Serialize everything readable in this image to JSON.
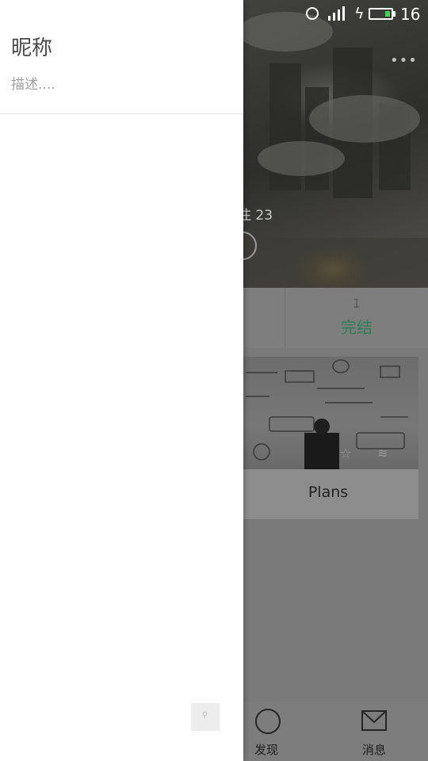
{
  "status_bar": {
    "battery_level": "16",
    "icons": [
      "alarm-clock-icon",
      "signal-icon",
      "charging-bolt-icon",
      "battery-icon"
    ]
  },
  "drawer": {
    "nickname": "昵称",
    "description_placeholder": "描述...."
  },
  "profile": {
    "follow_count_text": "注 23"
  },
  "stats": {
    "count": "1",
    "label": "完结"
  },
  "card": {
    "title": "Plans"
  },
  "tabbar": {
    "discover_label": "发现",
    "messages_label": "消息"
  },
  "colors": {
    "accent_green": "#2f7d5a",
    "battery_green": "#3fd35a"
  }
}
